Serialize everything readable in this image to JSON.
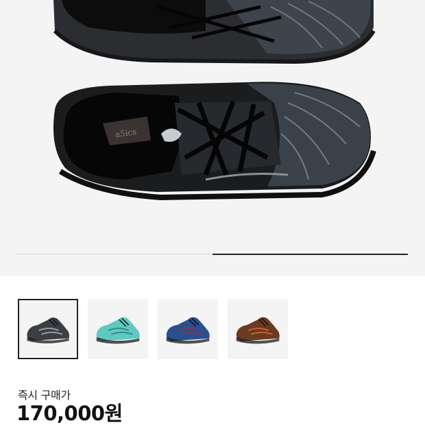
{
  "product": {
    "gallery": {
      "slide_progress": {
        "start_fraction": 0.5,
        "end_fraction": 1.0
      }
    },
    "thumbnails": [
      {
        "name": "black-colorway",
        "color": "#3b3f44",
        "accent": "#9aa0a6",
        "selected": true
      },
      {
        "name": "teal-colorway",
        "color": "#5fc9c0",
        "accent": "#2f8f88",
        "selected": false
      },
      {
        "name": "blue-colorway",
        "color": "#2a4f8f",
        "accent": "#7a3a55",
        "selected": false
      },
      {
        "name": "brown-colorway",
        "color": "#6a3a22",
        "accent": "#c8622a",
        "selected": false
      }
    ],
    "price_label": "즉시 구매가",
    "price": "170,000원"
  }
}
